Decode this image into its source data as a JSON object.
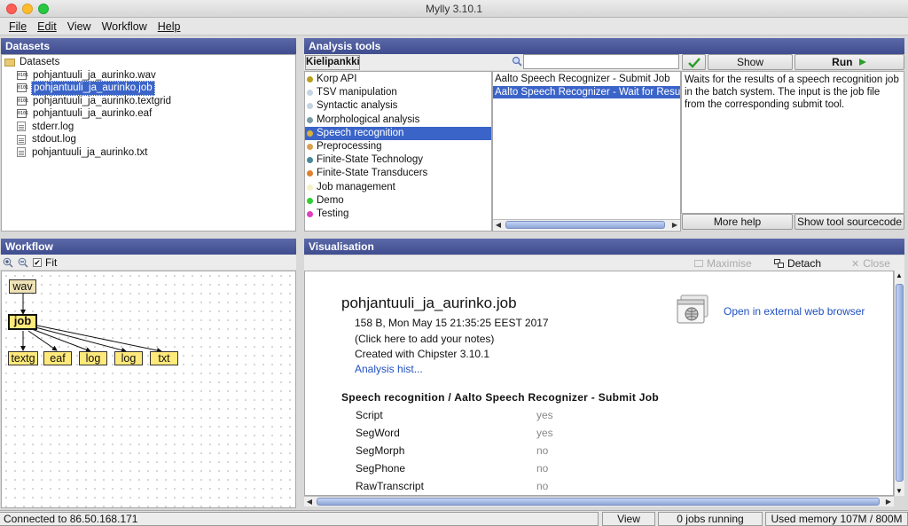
{
  "window": {
    "title": "Mylly 3.10.1"
  },
  "menu": [
    "File",
    "Edit",
    "View",
    "Workflow",
    "Help"
  ],
  "datasets": {
    "header": "Datasets",
    "root": "Datasets",
    "files": [
      {
        "name": "pohjantuuli_ja_aurinko.wav",
        "icon": "binary-file-icon",
        "selected": false
      },
      {
        "name": "pohjantuuli_ja_aurinko.job",
        "icon": "binary-file-icon",
        "selected": true
      },
      {
        "name": "pohjantuuli_ja_aurinko.textgrid",
        "icon": "binary-file-icon",
        "selected": false
      },
      {
        "name": "pohjantuuli_ja_aurinko.eaf",
        "icon": "binary-file-icon",
        "selected": false
      },
      {
        "name": "stderr.log",
        "icon": "text-file-icon",
        "selected": false
      },
      {
        "name": "stdout.log",
        "icon": "text-file-icon",
        "selected": false
      },
      {
        "name": "pohjantuuli_ja_aurinko.txt",
        "icon": "text-file-icon",
        "selected": false
      }
    ]
  },
  "analysis": {
    "header": "Analysis tools",
    "tab": "Kielipankki",
    "search": {
      "value": "",
      "placeholder": ""
    },
    "buttons": {
      "show_parameters": "Show parameters",
      "run": "Run",
      "more_help": "More help",
      "show_source": "Show tool sourcecode"
    },
    "categories": [
      {
        "label": "Korp API",
        "color": "#b8a020",
        "selected": false
      },
      {
        "label": "TSV manipulation",
        "color": "#c5d4e4",
        "selected": false
      },
      {
        "label": "Syntactic analysis",
        "color": "#c5d4e4",
        "selected": false
      },
      {
        "label": "Morphological analysis",
        "color": "#7a9aa8",
        "selected": false
      },
      {
        "label": "Speech recognition",
        "color": "#d8b040",
        "selected": true
      },
      {
        "label": "Preprocessing",
        "color": "#d8a050",
        "selected": false
      },
      {
        "label": "Finite-State Technology",
        "color": "#4a8898",
        "selected": false
      },
      {
        "label": "Finite-State Transducers",
        "color": "#e08030",
        "selected": false
      },
      {
        "label": "Job management",
        "color": "#f4f0c8",
        "selected": false
      },
      {
        "label": "Demo",
        "color": "#30d030",
        "selected": false
      },
      {
        "label": "Testing",
        "color": "#e040c0",
        "selected": false
      }
    ],
    "tools": [
      {
        "label": "Aalto Speech Recognizer - Submit Job",
        "selected": false
      },
      {
        "label": "Aalto Speech Recognizer - Wait for Results",
        "selected": true
      }
    ],
    "description": "Waits for the results of a speech recognition job in the batch system. The input is the job file from the corresponding submit tool."
  },
  "workflow": {
    "header": "Workflow",
    "fit_label": "Fit",
    "fit_checked": true,
    "nodes": {
      "wav": "wav",
      "job": "job",
      "textgrid": "textg",
      "eaf": "eaf",
      "log1": "log",
      "log2": "log",
      "txt": "txt"
    }
  },
  "visualisation": {
    "header": "Visualisation",
    "toolbar": {
      "maximise": "Maximise",
      "detach": "Detach",
      "close": "Close"
    },
    "file_title": "pohjantuuli_ja_aurinko.job",
    "meta": "158 B, Mon May 15 21:35:25 EEST 2017",
    "notes": "(Click here to add your notes)",
    "created": "Created with Chipster 3.10.1",
    "history_link": "Analysis hist...",
    "open_browser": "Open in external web browser",
    "section": "Speech recognition / Aalto Speech Recognizer - Submit Job",
    "params": [
      {
        "name": "Script",
        "value": "yes"
      },
      {
        "name": "SegWord",
        "value": "yes"
      },
      {
        "name": "SegMorph",
        "value": "no"
      },
      {
        "name": "SegPhone",
        "value": "no"
      },
      {
        "name": "RawTranscript",
        "value": "no"
      }
    ]
  },
  "status": {
    "connection": "Connected to 86.50.168.171",
    "view_jobs": "View jobs",
    "jobs_running": "0 jobs running",
    "memory": "Used memory 107M / 800M"
  }
}
